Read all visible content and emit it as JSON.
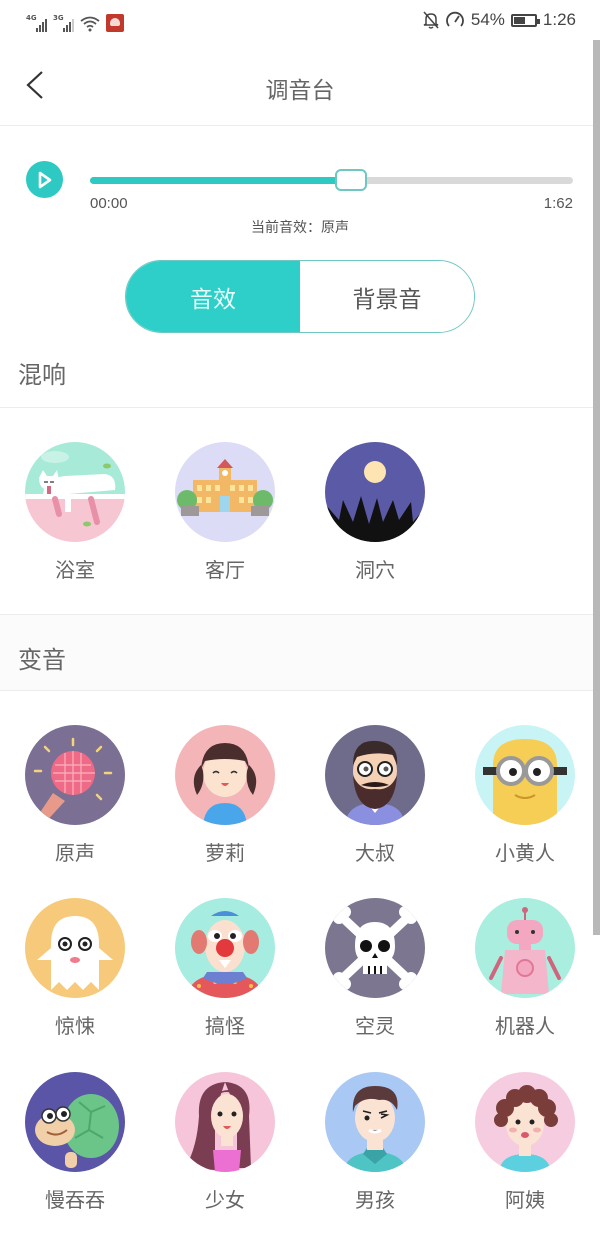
{
  "status_bar": {
    "signal_1_tag": "4G",
    "signal_2_tag": "3G",
    "battery_percent": "54%",
    "battery_level": 0.54,
    "time": "1:26",
    "icons": [
      "signal-4g-icon",
      "signal-3g-icon",
      "wifi-icon",
      "app-notification-icon",
      "mute-bell-icon",
      "data-saver-icon",
      "battery-icon"
    ]
  },
  "header": {
    "title": "调音台",
    "back_icon": "chevron-left-icon"
  },
  "player": {
    "play_icon": "play-icon",
    "progress": 0.54,
    "time_start": "00:00",
    "time_end": "1:62",
    "current_effect_label": "当前音效：原声"
  },
  "tabs": [
    {
      "label": "音效",
      "active": true
    },
    {
      "label": "背景音",
      "active": false
    }
  ],
  "sections": {
    "reverb": {
      "title": "混响",
      "items": [
        {
          "label": "浴室",
          "icon": "bathroom-cat-icon"
        },
        {
          "label": "客厅",
          "icon": "living-room-building-icon"
        },
        {
          "label": "洞穴",
          "icon": "cave-moon-icon"
        }
      ]
    },
    "voice_change": {
      "title": "变音",
      "items": [
        {
          "label": "原声",
          "icon": "microphone-icon"
        },
        {
          "label": "萝莉",
          "icon": "little-girl-icon"
        },
        {
          "label": "大叔",
          "icon": "bearded-man-icon"
        },
        {
          "label": "小黄人",
          "icon": "minion-icon"
        },
        {
          "label": "惊悚",
          "icon": "ghost-icon"
        },
        {
          "label": "搞怪",
          "icon": "clown-icon"
        },
        {
          "label": "空灵",
          "icon": "skull-icon"
        },
        {
          "label": "机器人",
          "icon": "robot-icon"
        },
        {
          "label": "慢吞吞",
          "icon": "turtle-icon"
        },
        {
          "label": "少女",
          "icon": "young-woman-icon"
        },
        {
          "label": "男孩",
          "icon": "boy-icon"
        },
        {
          "label": "阿姨",
          "icon": "auntie-icon"
        }
      ]
    }
  },
  "colors": {
    "accent": "#2ec9c2",
    "accent_border": "#6fc7c2",
    "track_bg": "#d9d9d9"
  }
}
